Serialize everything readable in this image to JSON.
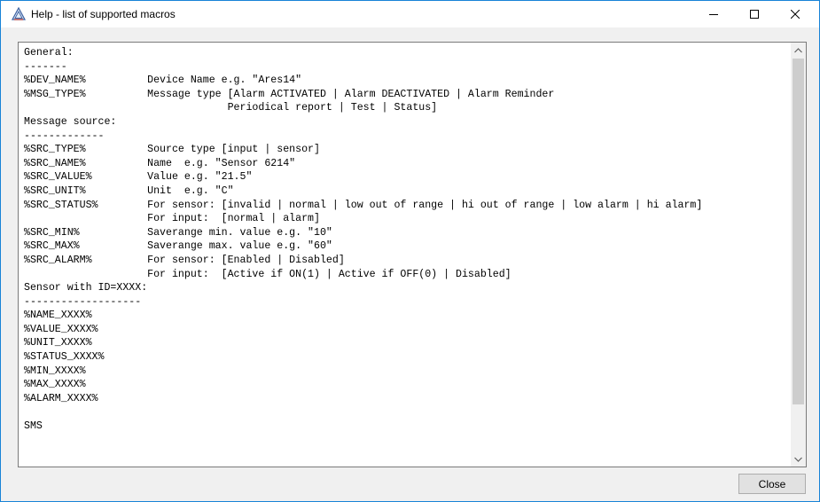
{
  "window": {
    "title": "Help - list of supported macros",
    "minimize_glyph": "—",
    "maximize_glyph": "☐",
    "close_glyph": "✕"
  },
  "colors": {
    "accent": "#1883d7",
    "scroll_thumb": "#cdcdcd"
  },
  "content": {
    "text": "General:\n-------\n%DEV_NAME%          Device Name e.g. \"Ares14\"\n%MSG_TYPE%          Message type [Alarm ACTIVATED | Alarm DEACTIVATED | Alarm Reminder\n                                 Periodical report | Test | Status]\nMessage source:\n-------------\n%SRC_TYPE%          Source type [input | sensor]\n%SRC_NAME%          Name  e.g. \"Sensor 6214\"\n%SRC_VALUE%         Value e.g. \"21.5\"\n%SRC_UNIT%          Unit  e.g. \"C\"\n%SRC_STATUS%        For sensor: [invalid | normal | low out of range | hi out of range | low alarm | hi alarm]\n                    For input:  [normal | alarm]\n%SRC_MIN%           Saverange min. value e.g. \"10\"\n%SRC_MAX%           Saverange max. value e.g. \"60\"\n%SRC_ALARM%         For sensor: [Enabled | Disabled]\n                    For input:  [Active if ON(1) | Active if OFF(0) | Disabled]\nSensor with ID=XXXX:\n-------------------\n%NAME_XXXX%\n%VALUE_XXXX%\n%UNIT_XXXX%\n%STATUS_XXXX%\n%MIN_XXXX%\n%MAX_XXXX%\n%ALARM_XXXX%\n\nSMS"
  },
  "scrollbar": {
    "up_icon": "chevron-up-icon",
    "down_icon": "chevron-down-icon"
  },
  "buttons": {
    "close_label": "Close"
  }
}
